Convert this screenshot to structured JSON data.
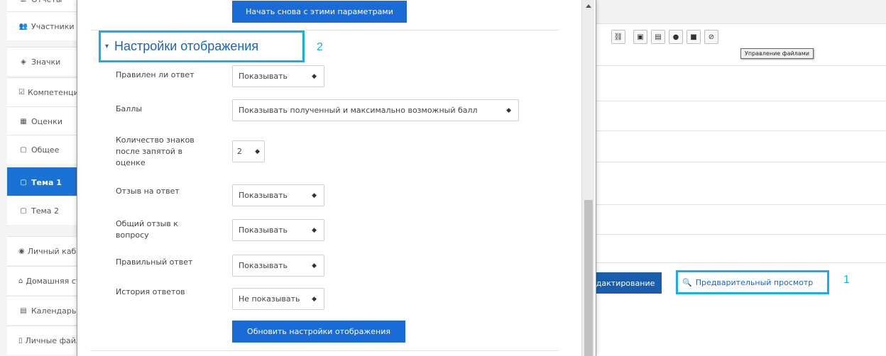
{
  "sidebar": {
    "items": [
      {
        "label": "Отчеты",
        "icon": "list-icon",
        "glyph": "☰"
      },
      {
        "label": "Участники",
        "icon": "users-icon",
        "glyph": "👥"
      },
      {
        "label": "Значки",
        "icon": "shield-icon",
        "glyph": "◈"
      },
      {
        "label": "Компетенции",
        "icon": "checkbox-icon",
        "glyph": "☑"
      },
      {
        "label": "Оценки",
        "icon": "table-icon",
        "glyph": "▦"
      },
      {
        "label": "Общее",
        "icon": "folder-icon",
        "glyph": "▢"
      },
      {
        "label": "Тема 1",
        "icon": "folder-icon",
        "glyph": "▢",
        "active": true
      },
      {
        "label": "Тема 2",
        "icon": "folder-icon",
        "glyph": "▢"
      },
      {
        "label": "Личный кабинет",
        "icon": "dashboard-icon",
        "glyph": "◉"
      },
      {
        "label": "Домашняя страница",
        "icon": "home-icon",
        "glyph": "⌂"
      },
      {
        "label": "Календарь",
        "icon": "calendar-icon",
        "glyph": "▤"
      },
      {
        "label": "Личные файлы",
        "icon": "file-icon",
        "glyph": "▯"
      }
    ]
  },
  "modal": {
    "restart_button": "Начать снова с этими параметрами",
    "section": {
      "title": "Настройки отображения",
      "toggle_glyph": "▾",
      "callout": "2"
    },
    "fields": [
      {
        "label": "Правилен ли ответ",
        "value": "Показывать"
      },
      {
        "label": "Баллы",
        "value": "Показывать полученный и максимально возможный балл"
      },
      {
        "label": "Количество знаков после запятой в оценке",
        "value": "2"
      },
      {
        "label": "Отзыв на ответ",
        "value": "Показывать"
      },
      {
        "label": "Общий отзыв к вопросу",
        "value": "Показывать"
      },
      {
        "label": "Правильный ответ",
        "value": "Показывать"
      },
      {
        "label": "История ответов",
        "value": "Не показывать"
      }
    ],
    "update_button": "Обновить настройки отображения",
    "caret_glyph": "◆"
  },
  "editor": {
    "tooltip": "Управление файлами",
    "edit_button": "едактирование",
    "preview_link": "Предварительный просмотр",
    "preview_icon_glyph": "🔍",
    "callout": "1",
    "toolbar": [
      {
        "icon": "unlink-icon",
        "glyph": "⛓"
      },
      {
        "icon": "image-icon",
        "glyph": "▣"
      },
      {
        "icon": "media-icon",
        "glyph": "▤"
      },
      {
        "icon": "microphone-icon",
        "glyph": "●"
      },
      {
        "icon": "video-icon",
        "glyph": "■"
      },
      {
        "icon": "manage-files-icon",
        "glyph": "⊘"
      }
    ]
  },
  "colors": {
    "accent": "#1a6bd6",
    "callout_border": "#19aee8",
    "link": "#1a63c4"
  }
}
